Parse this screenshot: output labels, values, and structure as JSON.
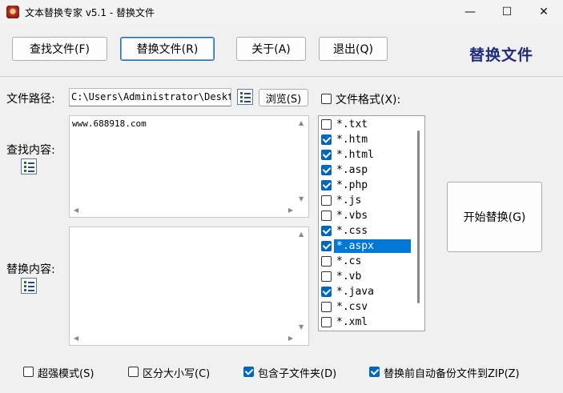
{
  "window": {
    "title": "文本替换专家 v5.1 - 替换文件",
    "minimize": "—",
    "maximize": "☐",
    "close": "✕"
  },
  "toolbar": {
    "find_files": "查找文件(F)",
    "replace_files": "替换文件(R)",
    "about": "关于(A)",
    "exit": "退出(Q)"
  },
  "heading": "替换文件",
  "path": {
    "label": "文件路径:",
    "value": "C:\\Users\\Administrator\\Deskto",
    "browse": "浏览(S)"
  },
  "format_toggle": {
    "label": "文件格式(X):",
    "checked": false
  },
  "find": {
    "label": "查找内容:",
    "text": "www.688918.com"
  },
  "replace": {
    "label": "替换内容:",
    "text": ""
  },
  "formats": [
    {
      "label": "*.txt",
      "checked": false
    },
    {
      "label": "*.htm",
      "checked": true
    },
    {
      "label": "*.html",
      "checked": true
    },
    {
      "label": "*.asp",
      "checked": true
    },
    {
      "label": "*.php",
      "checked": true
    },
    {
      "label": "*.js",
      "checked": false
    },
    {
      "label": "*.vbs",
      "checked": false
    },
    {
      "label": "*.css",
      "checked": true
    },
    {
      "label": "*.aspx",
      "checked": true,
      "selected": true
    },
    {
      "label": "*.cs",
      "checked": false
    },
    {
      "label": "*.vb",
      "checked": false
    },
    {
      "label": "*.java",
      "checked": true
    },
    {
      "label": "*.csv",
      "checked": false
    },
    {
      "label": "*.xml",
      "checked": false
    }
  ],
  "start_button": "开始替换(G)",
  "options": [
    {
      "label": "超强模式(S)",
      "checked": false
    },
    {
      "label": "区分大小写(C)",
      "checked": false
    },
    {
      "label": "包含子文件夹(D)",
      "checked": true
    },
    {
      "label": "替换前自动备份文件到ZIP(Z)",
      "checked": true
    }
  ],
  "colors": {
    "heading": "#1f2a7a",
    "checkbox_on": "#0067c0",
    "selection": "#0078d7"
  }
}
